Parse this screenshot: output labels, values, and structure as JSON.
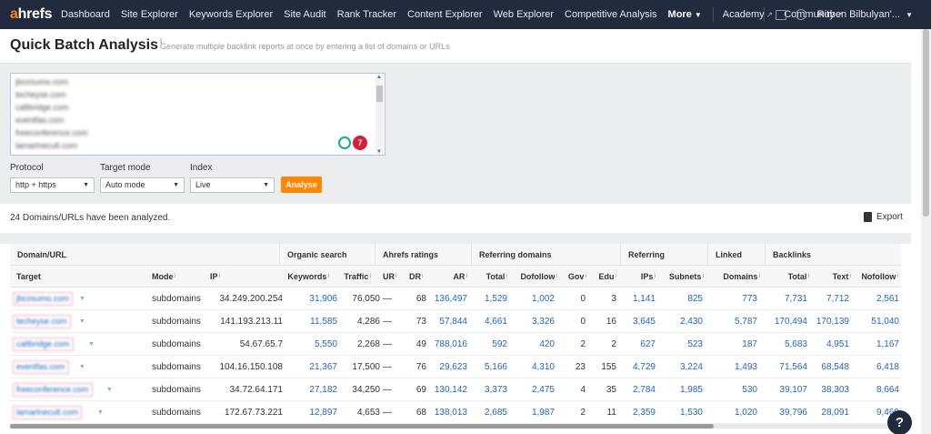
{
  "nav": {
    "logo_a": "a",
    "logo_rest": "hrefs",
    "links": [
      "Dashboard",
      "Site Explorer",
      "Keywords Explorer",
      "Site Audit",
      "Rank Tracker",
      "Content Explorer",
      "Web Explorer",
      "Competitive Analysis"
    ],
    "more": "More",
    "academy": "Academy",
    "community": "Community",
    "user": "Ruben Bilbulyan'..."
  },
  "page": {
    "title": "Quick Batch Analysis",
    "title_info": "i",
    "subtitle": "Generate multiple backlink reports at once by entering a list of domains or URLs"
  },
  "form": {
    "domains": [
      "jbcosumo.com",
      "techeyse.com",
      "caltbridge.com",
      "eventfas.com",
      "freeconference.com",
      "lamarlnecult.com"
    ],
    "badge_count": "7",
    "protocol_label": "Protocol",
    "protocol_value": "http + https",
    "target_mode_label": "Target mode",
    "target_mode_value": "Auto mode",
    "index_label": "Index",
    "index_value": "Live",
    "analyse_label": "Analyse"
  },
  "results": {
    "summary": "24 Domains/URLs have been analyzed.",
    "export_label": "Export"
  },
  "table": {
    "groups": [
      "Domain/URL",
      "Organic search",
      "Ahrefs ratings",
      "Referring domains",
      "Referring",
      "Linked",
      "Backlinks"
    ],
    "headers": [
      "Target",
      "Mode",
      "IP",
      "Keywords",
      "Traffic",
      "UR",
      "DR",
      "AR",
      "Total",
      "Dofollow",
      "Gov",
      "Edu",
      "IPs",
      "Subnets",
      "Domains",
      "Total",
      "Text",
      "Nofollow"
    ],
    "rows": [
      {
        "target": "jbcosumo.com",
        "mode": "subdomains",
        "ip": "34.249.200.254",
        "keywords": "31,906",
        "traffic": "76,050",
        "ur": "—",
        "dr": "68",
        "ar": "136,497",
        "rd_total": "1,529",
        "rd_dofollow": "1,002",
        "gov": "0",
        "edu": "3",
        "ips": "1,141",
        "subnets": "825",
        "linked": "773",
        "bl_total": "7,731",
        "bl_text": "7,712",
        "bl_nofollow": "2,561"
      },
      {
        "target": "techeyse.com",
        "mode": "subdomains",
        "ip": "141.193.213.11",
        "keywords": "11,585",
        "traffic": "4,286",
        "ur": "—",
        "dr": "73",
        "ar": "57,844",
        "rd_total": "4,661",
        "rd_dofollow": "3,326",
        "gov": "0",
        "edu": "16",
        "ips": "3,645",
        "subnets": "2,430",
        "linked": "5,787",
        "bl_total": "170,494",
        "bl_text": "170,139",
        "bl_nofollow": "51,040"
      },
      {
        "target": "caltbridge.com",
        "mode": "subdomains",
        "ip": "54.67.65.7",
        "keywords": "5,550",
        "traffic": "2,268",
        "ur": "—",
        "dr": "49",
        "ar": "788,016",
        "rd_total": "592",
        "rd_dofollow": "420",
        "gov": "2",
        "edu": "2",
        "ips": "627",
        "subnets": "523",
        "linked": "187",
        "bl_total": "5,683",
        "bl_text": "4,951",
        "bl_nofollow": "1,167"
      },
      {
        "target": "eventfas.com",
        "mode": "subdomains",
        "ip": "104.16.150.108",
        "keywords": "21,367",
        "traffic": "17,500",
        "ur": "—",
        "dr": "76",
        "ar": "29,623",
        "rd_total": "5,166",
        "rd_dofollow": "4,310",
        "gov": "23",
        "edu": "155",
        "ips": "4,729",
        "subnets": "3,224",
        "linked": "1,493",
        "bl_total": "71,564",
        "bl_text": "68,548",
        "bl_nofollow": "6,418"
      },
      {
        "target": "freeconference.com",
        "mode": "subdomains",
        "ip": "34.72.64.171",
        "keywords": "27,182",
        "traffic": "34,250",
        "ur": "—",
        "dr": "69",
        "ar": "130,142",
        "rd_total": "3,373",
        "rd_dofollow": "2,475",
        "gov": "4",
        "edu": "35",
        "ips": "2,784",
        "subnets": "1,985",
        "linked": "530",
        "bl_total": "39,107",
        "bl_text": "38,303",
        "bl_nofollow": "8,664"
      },
      {
        "target": "lamarlnecult.com",
        "mode": "subdomains",
        "ip": "172.67.73.221",
        "keywords": "12,897",
        "traffic": "4,653",
        "ur": "—",
        "dr": "68",
        "ar": "138,013",
        "rd_total": "2,685",
        "rd_dofollow": "1,987",
        "gov": "2",
        "edu": "11",
        "ips": "2,359",
        "subnets": "1,530",
        "linked": "1,020",
        "bl_total": "39,796",
        "bl_text": "28,091",
        "bl_nofollow": "9,469"
      }
    ]
  },
  "help_label": "?"
}
